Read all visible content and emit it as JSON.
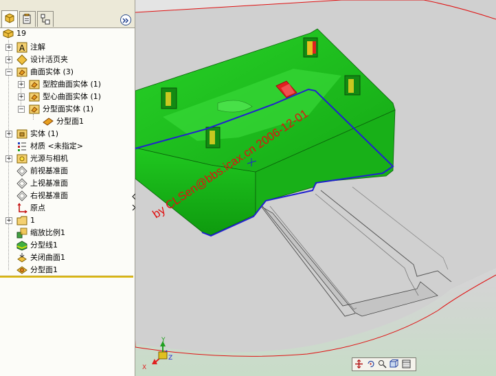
{
  "colors": {
    "model": "#1ec81e",
    "partline": "#2020d0",
    "watermark": "#e01010",
    "sketch": "#e01010",
    "background": "#d8d8d8"
  },
  "panel": {
    "tabs": [
      "feature-manager-icon",
      "property-manager-icon",
      "configuration-manager-icon"
    ],
    "collapse_icon": "double-chevron-right-icon"
  },
  "tree": {
    "root": "19",
    "items": [
      {
        "label": "注解",
        "expander": "+"
      },
      {
        "label": "设计活页夹",
        "expander": "+"
      },
      {
        "label": "曲面实体 (3)",
        "expander": "−"
      },
      {
        "label": "型腔曲面实体 (1)",
        "expander": "+"
      },
      {
        "label": "型心曲面实体 (1)",
        "expander": "+"
      },
      {
        "label": "分型面实体 (1)",
        "expander": "−"
      },
      {
        "label": "分型面1",
        "expander": ""
      },
      {
        "label": "实体 (1)",
        "expander": "+"
      },
      {
        "label": "材质 <未指定>",
        "expander": ""
      },
      {
        "label": "光源与相机",
        "expander": "+"
      },
      {
        "label": "前视基准面",
        "expander": ""
      },
      {
        "label": "上视基准面",
        "expander": ""
      },
      {
        "label": "右视基准面",
        "expander": ""
      },
      {
        "label": "原点",
        "expander": ""
      },
      {
        "label": "1",
        "expander": "+"
      },
      {
        "label": "缩放比例1",
        "expander": ""
      },
      {
        "label": "分型线1",
        "expander": ""
      },
      {
        "label": "关闭曲面1",
        "expander": ""
      },
      {
        "label": "分型面1",
        "expander": ""
      }
    ]
  },
  "viewport": {
    "watermark": "by CLSen@bbs.icax.cn 2006-12-01",
    "triad": {
      "x": "X",
      "y": "Y",
      "z": "Z"
    },
    "view_toolbar": [
      "pan-icon",
      "rotate-icon",
      "zoom-icon",
      "view-orientation-icon",
      "display-style-icon"
    ]
  }
}
